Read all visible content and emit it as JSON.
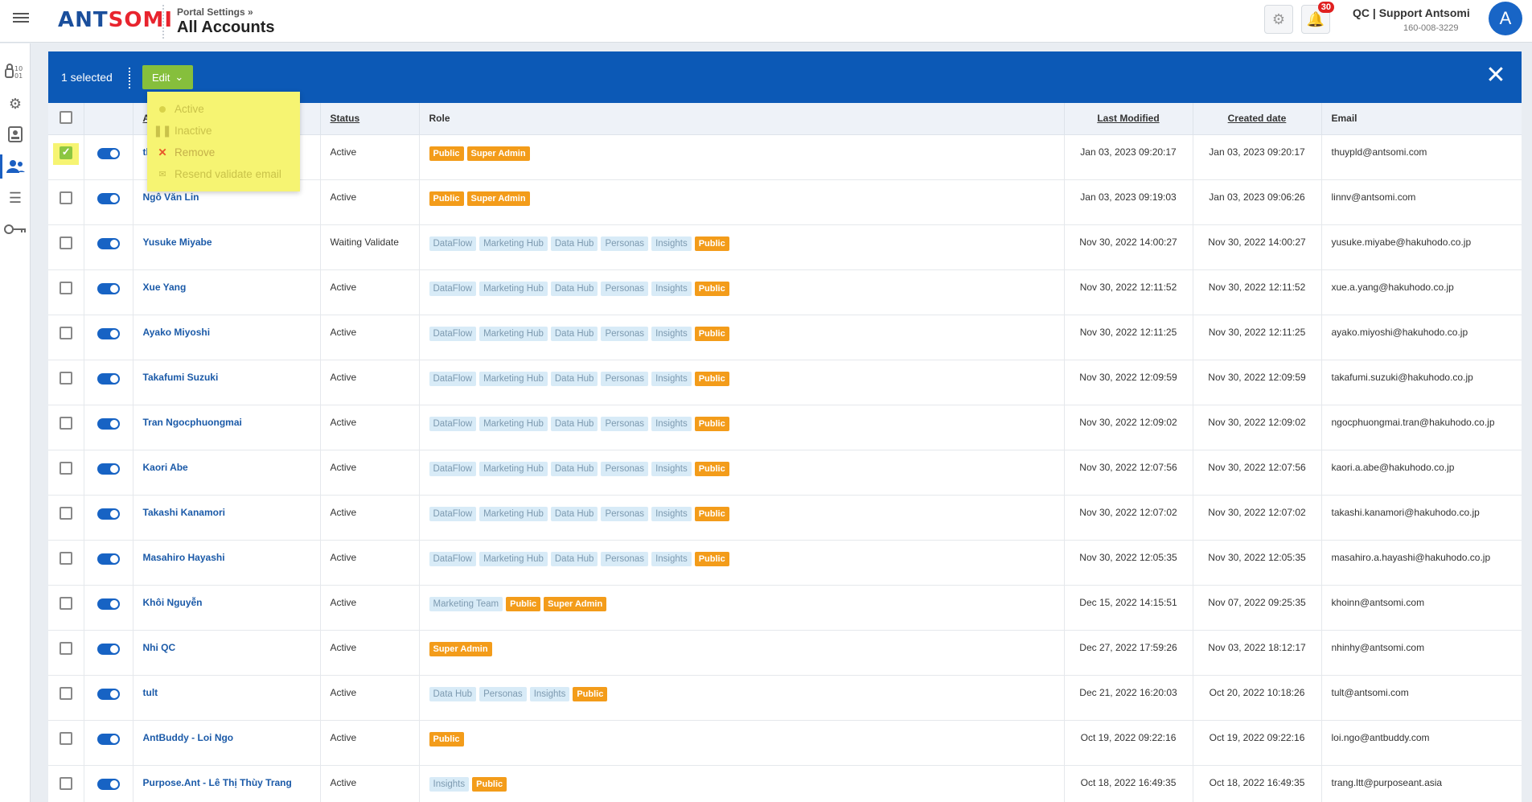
{
  "header": {
    "logo_text_1": "ANT",
    "logo_text_2": "SOMI",
    "breadcrumb": "Portal Settings »",
    "title": "All Accounts",
    "notification_count": "30",
    "account_name": "QC | Support Antsomi",
    "account_id": "160-008-3229",
    "avatar_initial": "A"
  },
  "selection_bar": {
    "selected_text": "1 selected",
    "edit_label": "Edit",
    "close_symbol": "✕"
  },
  "edit_menu": [
    {
      "label": "Active",
      "icon": "circle-dot-icon"
    },
    {
      "label": "Inactive",
      "icon": "pause-icon"
    },
    {
      "label": "Remove",
      "icon": "x-icon"
    },
    {
      "label": "Resend validate email",
      "icon": "mail-icon"
    }
  ],
  "table": {
    "columns": {
      "account": "A",
      "status": "Status",
      "role": "Role",
      "last_modified": "Last Modified",
      "created_date": "Created date",
      "email": "Email"
    },
    "rows": [
      {
        "name": "thuypld",
        "status": "Active",
        "tags": [
          [
            "Public",
            "o"
          ],
          [
            "Super Admin",
            "o"
          ]
        ],
        "modified": "Jan 03, 2023 09:20:17",
        "created": "Jan 03, 2023 09:20:17",
        "email": "thuypld@antsomi.com",
        "checked": true
      },
      {
        "name": "Ngô Văn Lin",
        "status": "Active",
        "tags": [
          [
            "Public",
            "o"
          ],
          [
            "Super Admin",
            "o"
          ]
        ],
        "modified": "Jan 03, 2023 09:19:03",
        "created": "Jan 03, 2023 09:06:26",
        "email": "linnv@antsomi.com"
      },
      {
        "name": "Yusuke Miyabe",
        "status": "Waiting Validate",
        "tags": [
          [
            "DataFlow",
            "b"
          ],
          [
            "Marketing Hub",
            "b"
          ],
          [
            "Data Hub",
            "b"
          ],
          [
            "Personas",
            "b"
          ],
          [
            "Insights",
            "b"
          ],
          [
            "Public",
            "o"
          ]
        ],
        "modified": "Nov 30, 2022 14:00:27",
        "created": "Nov 30, 2022 14:00:27",
        "email": "yusuke.miyabe@hakuhodo.co.jp"
      },
      {
        "name": "Xue Yang",
        "status": "Active",
        "tags": [
          [
            "DataFlow",
            "b"
          ],
          [
            "Marketing Hub",
            "b"
          ],
          [
            "Data Hub",
            "b"
          ],
          [
            "Personas",
            "b"
          ],
          [
            "Insights",
            "b"
          ],
          [
            "Public",
            "o"
          ]
        ],
        "modified": "Nov 30, 2022 12:11:52",
        "created": "Nov 30, 2022 12:11:52",
        "email": "xue.a.yang@hakuhodo.co.jp"
      },
      {
        "name": "Ayako Miyoshi",
        "status": "Active",
        "tags": [
          [
            "DataFlow",
            "b"
          ],
          [
            "Marketing Hub",
            "b"
          ],
          [
            "Data Hub",
            "b"
          ],
          [
            "Personas",
            "b"
          ],
          [
            "Insights",
            "b"
          ],
          [
            "Public",
            "o"
          ]
        ],
        "modified": "Nov 30, 2022 12:11:25",
        "created": "Nov 30, 2022 12:11:25",
        "email": "ayako.miyoshi@hakuhodo.co.jp"
      },
      {
        "name": "Takafumi Suzuki",
        "status": "Active",
        "tags": [
          [
            "DataFlow",
            "b"
          ],
          [
            "Marketing Hub",
            "b"
          ],
          [
            "Data Hub",
            "b"
          ],
          [
            "Personas",
            "b"
          ],
          [
            "Insights",
            "b"
          ],
          [
            "Public",
            "o"
          ]
        ],
        "modified": "Nov 30, 2022 12:09:59",
        "created": "Nov 30, 2022 12:09:59",
        "email": "takafumi.suzuki@hakuhodo.co.jp"
      },
      {
        "name": "Tran Ngocphuongmai",
        "status": "Active",
        "tags": [
          [
            "DataFlow",
            "b"
          ],
          [
            "Marketing Hub",
            "b"
          ],
          [
            "Data Hub",
            "b"
          ],
          [
            "Personas",
            "b"
          ],
          [
            "Insights",
            "b"
          ],
          [
            "Public",
            "o"
          ]
        ],
        "modified": "Nov 30, 2022 12:09:02",
        "created": "Nov 30, 2022 12:09:02",
        "email": "ngocphuongmai.tran@hakuhodo.co.jp"
      },
      {
        "name": "Kaori Abe",
        "status": "Active",
        "tags": [
          [
            "DataFlow",
            "b"
          ],
          [
            "Marketing Hub",
            "b"
          ],
          [
            "Data Hub",
            "b"
          ],
          [
            "Personas",
            "b"
          ],
          [
            "Insights",
            "b"
          ],
          [
            "Public",
            "o"
          ]
        ],
        "modified": "Nov 30, 2022 12:07:56",
        "created": "Nov 30, 2022 12:07:56",
        "email": "kaori.a.abe@hakuhodo.co.jp"
      },
      {
        "name": "Takashi Kanamori",
        "status": "Active",
        "tags": [
          [
            "DataFlow",
            "b"
          ],
          [
            "Marketing Hub",
            "b"
          ],
          [
            "Data Hub",
            "b"
          ],
          [
            "Personas",
            "b"
          ],
          [
            "Insights",
            "b"
          ],
          [
            "Public",
            "o"
          ]
        ],
        "modified": "Nov 30, 2022 12:07:02",
        "created": "Nov 30, 2022 12:07:02",
        "email": "takashi.kanamori@hakuhodo.co.jp"
      },
      {
        "name": "Masahiro Hayashi",
        "status": "Active",
        "tags": [
          [
            "DataFlow",
            "b"
          ],
          [
            "Marketing Hub",
            "b"
          ],
          [
            "Data Hub",
            "b"
          ],
          [
            "Personas",
            "b"
          ],
          [
            "Insights",
            "b"
          ],
          [
            "Public",
            "o"
          ]
        ],
        "modified": "Nov 30, 2022 12:05:35",
        "created": "Nov 30, 2022 12:05:35",
        "email": "masahiro.a.hayashi@hakuhodo.co.jp"
      },
      {
        "name": "Khôi Nguyễn",
        "status": "Active",
        "tags": [
          [
            "Marketing Team",
            "b"
          ],
          [
            "Public",
            "o"
          ],
          [
            "Super Admin",
            "o"
          ]
        ],
        "modified": "Dec 15, 2022 14:15:51",
        "created": "Nov 07, 2022 09:25:35",
        "email": "khoinn@antsomi.com"
      },
      {
        "name": "Nhi QC",
        "status": "Active",
        "tags": [
          [
            "Super Admin",
            "o"
          ]
        ],
        "modified": "Dec 27, 2022 17:59:26",
        "created": "Nov 03, 2022 18:12:17",
        "email": "nhinhy@antsomi.com"
      },
      {
        "name": "tult",
        "status": "Active",
        "tags": [
          [
            "Data Hub",
            "b"
          ],
          [
            "Personas",
            "b"
          ],
          [
            "Insights",
            "b"
          ],
          [
            "Public",
            "o"
          ]
        ],
        "modified": "Dec 21, 2022 16:20:03",
        "created": "Oct 20, 2022 10:18:26",
        "email": "tult@antsomi.com"
      },
      {
        "name": "AntBuddy - Loi Ngo",
        "status": "Active",
        "tags": [
          [
            "Public",
            "o"
          ]
        ],
        "modified": "Oct 19, 2022 09:22:16",
        "created": "Oct 19, 2022 09:22:16",
        "email": "loi.ngo@antbuddy.com"
      },
      {
        "name": "Purpose.Ant - Lê Thị Thùy Trang",
        "status": "Active",
        "tags": [
          [
            "Insights",
            "b"
          ],
          [
            "Public",
            "o"
          ]
        ],
        "modified": "Oct 18, 2022 16:49:35",
        "created": "Oct 18, 2022 16:49:35",
        "email": "trang.ltt@purposeant.asia"
      }
    ]
  },
  "rail_icons": [
    "data-icon",
    "settings-gears-icon",
    "contact-card-icon",
    "users-icon",
    "list-icon",
    "key-icon"
  ]
}
